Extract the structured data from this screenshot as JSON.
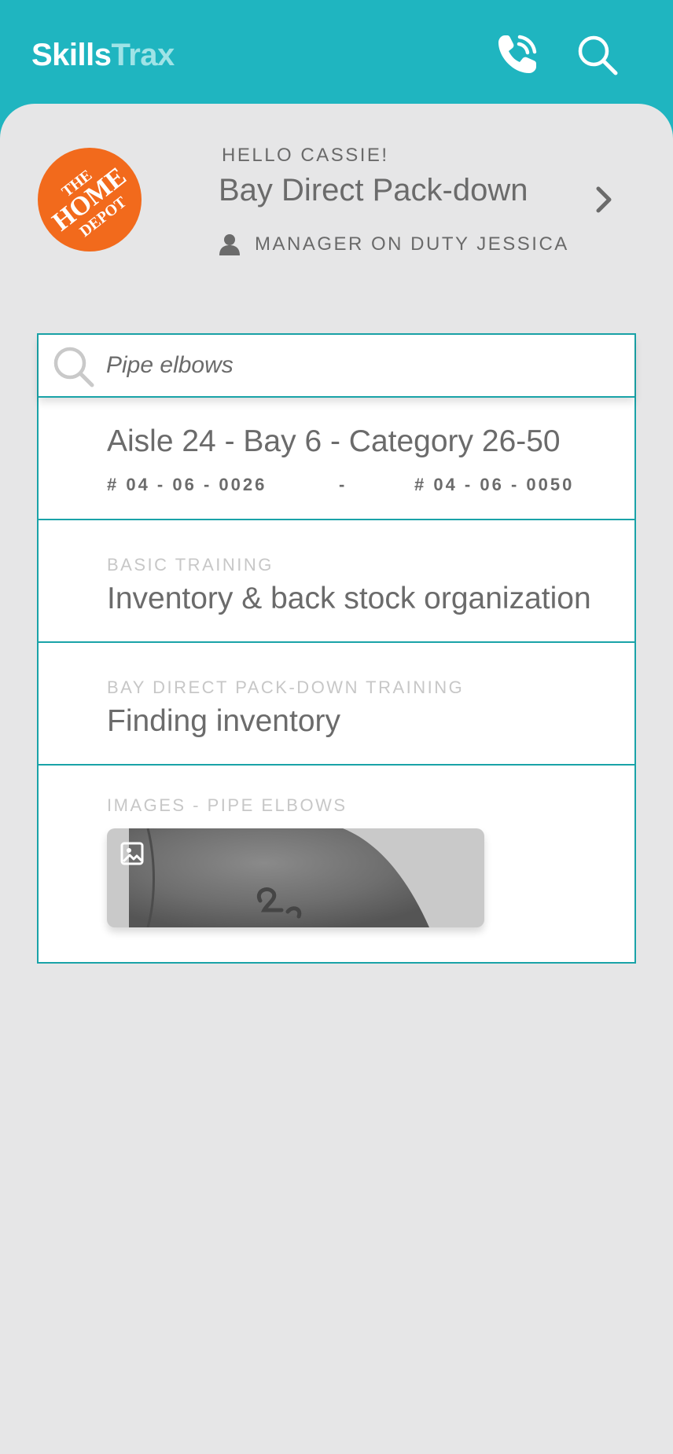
{
  "app": {
    "logo_part1": "Skills",
    "logo_part2": "Trax",
    "icons": {
      "phone": "phone-ringing-icon",
      "search": "search-icon"
    },
    "colors": {
      "brand_teal": "#1fb5c0",
      "panel_border": "#1aa3a8",
      "store_orange": "#f26a1c"
    }
  },
  "store": {
    "logo_name": "The Home Depot logo",
    "logo_lines": [
      "THE",
      "HOME",
      "DEPOT"
    ],
    "greeting": "HELLO CASSIE!",
    "title": "Bay Direct Pack-down",
    "manager": "MANAGER ON DUTY JESSICA"
  },
  "search": {
    "value": "Pipe elbows",
    "placeholder": ""
  },
  "results": {
    "location": {
      "title": "Aisle 24 - Bay 6 - Category 26-50",
      "code_start": "# 04 - 06 - 0026",
      "separator": "-",
      "code_end": "# 04 - 06 - 0050"
    },
    "items": [
      {
        "category": "BASIC TRAINING",
        "title": "Inventory & back stock organization"
      },
      {
        "category": "BAY DIRECT PACK-DOWN TRAINING",
        "title": "Finding inventory"
      }
    ],
    "images": {
      "category": "IMAGES - PIPE ELBOWS",
      "thumb_icon": "image-icon"
    }
  }
}
